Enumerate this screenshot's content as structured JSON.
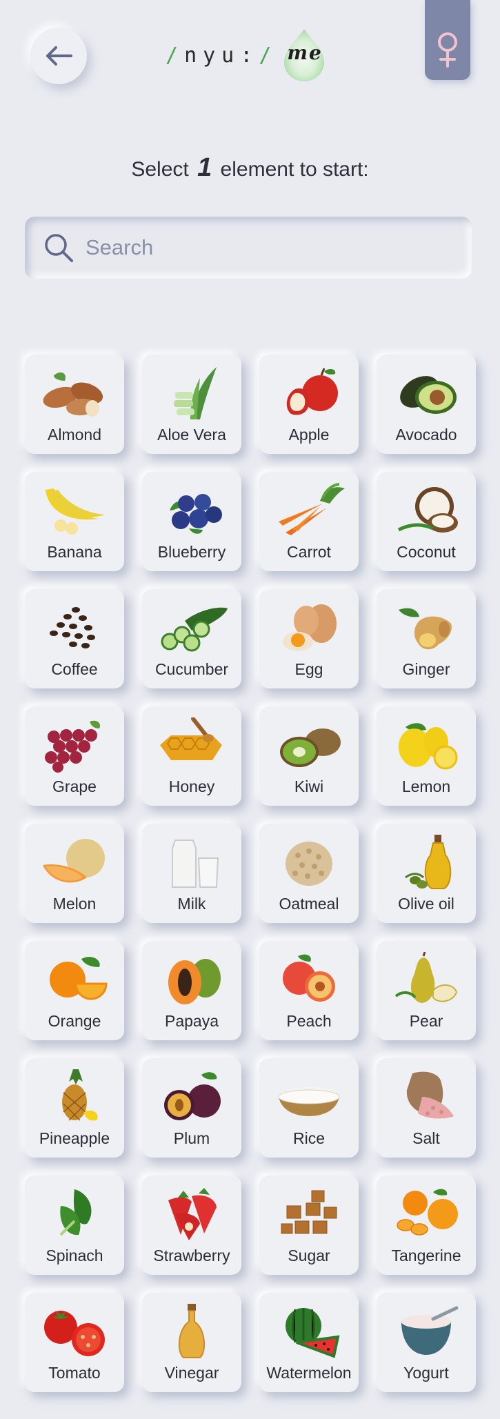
{
  "header": {
    "back_icon": "arrow-left-icon",
    "logo_prefix": "/",
    "logo_word": "nyu:",
    "logo_suffix": "/",
    "logo_drop_text": "me",
    "gender_icon": "female-symbol-icon",
    "gender_color": "#7e87a7"
  },
  "prompt": {
    "before": "Select",
    "count": "1",
    "after": "element to start:"
  },
  "search": {
    "placeholder": "Search",
    "value": "",
    "icon": "search-icon"
  },
  "items": [
    {
      "label": "Almond",
      "icon": "almond-icon"
    },
    {
      "label": "Aloe Vera",
      "icon": "aloe-vera-icon"
    },
    {
      "label": "Apple",
      "icon": "apple-icon"
    },
    {
      "label": "Avocado",
      "icon": "avocado-icon"
    },
    {
      "label": "Banana",
      "icon": "banana-icon"
    },
    {
      "label": "Blueberry",
      "icon": "blueberry-icon"
    },
    {
      "label": "Carrot",
      "icon": "carrot-icon"
    },
    {
      "label": "Coconut",
      "icon": "coconut-icon"
    },
    {
      "label": "Coffee",
      "icon": "coffee-icon"
    },
    {
      "label": "Cucumber",
      "icon": "cucumber-icon"
    },
    {
      "label": "Egg",
      "icon": "egg-icon"
    },
    {
      "label": "Ginger",
      "icon": "ginger-icon"
    },
    {
      "label": "Grape",
      "icon": "grape-icon"
    },
    {
      "label": "Honey",
      "icon": "honey-icon"
    },
    {
      "label": "Kiwi",
      "icon": "kiwi-icon"
    },
    {
      "label": "Lemon",
      "icon": "lemon-icon"
    },
    {
      "label": "Melon",
      "icon": "melon-icon"
    },
    {
      "label": "Milk",
      "icon": "milk-icon"
    },
    {
      "label": "Oatmeal",
      "icon": "oatmeal-icon"
    },
    {
      "label": "Olive oil",
      "icon": "olive-oil-icon"
    },
    {
      "label": "Orange",
      "icon": "orange-icon"
    },
    {
      "label": "Papaya",
      "icon": "papaya-icon"
    },
    {
      "label": "Peach",
      "icon": "peach-icon"
    },
    {
      "label": "Pear",
      "icon": "pear-icon"
    },
    {
      "label": "Pineapple",
      "icon": "pineapple-icon"
    },
    {
      "label": "Plum",
      "icon": "plum-icon"
    },
    {
      "label": "Rice",
      "icon": "rice-icon"
    },
    {
      "label": "Salt",
      "icon": "salt-icon"
    },
    {
      "label": "Spinach",
      "icon": "spinach-icon"
    },
    {
      "label": "Strawberry",
      "icon": "strawberry-icon"
    },
    {
      "label": "Sugar",
      "icon": "sugar-icon"
    },
    {
      "label": "Tangerine",
      "icon": "tangerine-icon"
    },
    {
      "label": "Tomato",
      "icon": "tomato-icon"
    },
    {
      "label": "Vinegar",
      "icon": "vinegar-icon"
    },
    {
      "label": "Watermelon",
      "icon": "watermelon-icon"
    },
    {
      "label": "Yogurt",
      "icon": "yogurt-icon"
    }
  ]
}
